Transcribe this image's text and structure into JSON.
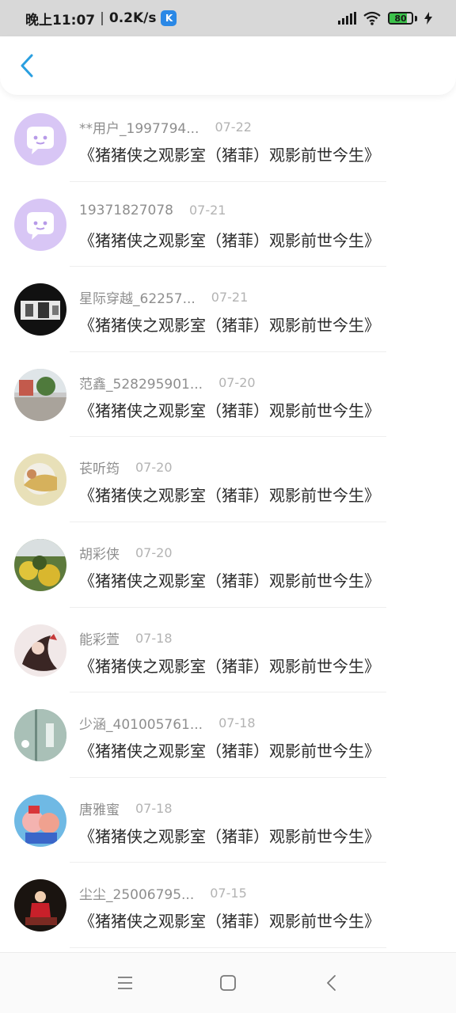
{
  "status_bar": {
    "time": "晚上11:07",
    "net_speed": "0.2K/s",
    "app_badge": "K",
    "battery_level": 80,
    "battery_text": "80",
    "battery_color": "#3cc24b"
  },
  "header": {
    "back_icon": "chevron-left-icon",
    "accent": "#2a9fe0"
  },
  "messages": [
    {
      "username": "**用户_1997794...",
      "date": "07-22",
      "text": "《猪猪侠之观影室（猪菲）观影前世今生》",
      "avatar": "default-chat-avatar"
    },
    {
      "username": "19371827078",
      "date": "07-21",
      "text": "《猪猪侠之观影室（猪菲）观影前世今生》",
      "avatar": "default-chat-avatar"
    },
    {
      "username": "星际穿越_62257...",
      "date": "07-21",
      "text": "《猪猪侠之观影室（猪菲）观影前世今生》",
      "avatar": "photo-avatar"
    },
    {
      "username": "范鑫_528295901...",
      "date": "07-20",
      "text": "《猪猪侠之观影室（猪菲）观影前世今生》",
      "avatar": "photo-avatar"
    },
    {
      "username": "苌听筠",
      "date": "07-20",
      "text": "《猪猪侠之观影室（猪菲）观影前世今生》",
      "avatar": "photo-avatar"
    },
    {
      "username": "胡彩侠",
      "date": "07-20",
      "text": "《猪猪侠之观影室（猪菲）观影前世今生》",
      "avatar": "photo-avatar"
    },
    {
      "username": "能彩萱",
      "date": "07-18",
      "text": "《猪猪侠之观影室（猪菲）观影前世今生》",
      "avatar": "photo-avatar"
    },
    {
      "username": "少涵_401005761...",
      "date": "07-18",
      "text": "《猪猪侠之观影室（猪菲）观影前世今生》",
      "avatar": "photo-avatar"
    },
    {
      "username": "唐雅蜜",
      "date": "07-18",
      "text": "《猪猪侠之观影室（猪菲）观影前世今生》",
      "avatar": "photo-avatar"
    },
    {
      "username": "尘尘_25006795...",
      "date": "07-15",
      "text": "《猪猪侠之观影室（猪菲）观影前世今生》",
      "avatar": "photo-avatar"
    }
  ],
  "nav_bar": {
    "menu_icon": "menu-icon",
    "home_icon": "home-square-icon",
    "back_icon": "back-triangle-icon"
  }
}
